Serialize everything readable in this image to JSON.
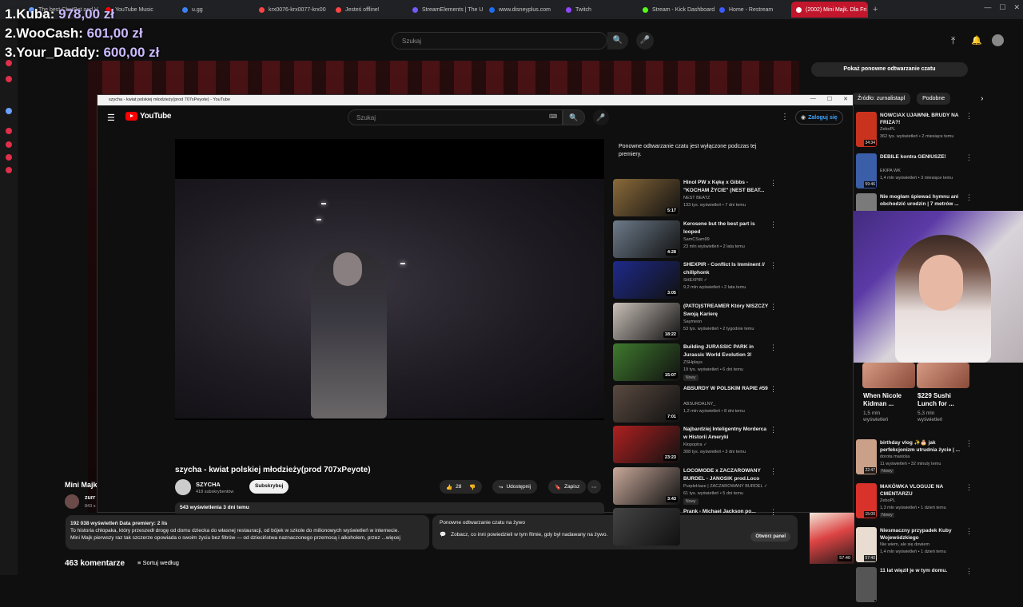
{
  "browser": {
    "tabs": [
      {
        "label": "The best ChatBot and V",
        "color": "#6aa0ff"
      },
      {
        "label": "YouTube Music",
        "color": "#ff0000"
      },
      {
        "label": "u.gg",
        "color": "#3b82f6"
      },
      {
        "label": "krx0076-krx0077-krx00",
        "color": "#ff4444"
      },
      {
        "label": "Jesteś offline!",
        "color": "#ff4444"
      },
      {
        "label": "StreamElements | The U",
        "color": "#6f5bff"
      },
      {
        "label": "www.disneyplus.com",
        "color": "#1b6ef3"
      },
      {
        "label": "Twitch",
        "color": "#9146ff"
      },
      {
        "label": "Stream - Kick Dashboard",
        "color": "#53fc18"
      },
      {
        "label": "Home - Restream",
        "color": "#3b5bfd"
      },
      {
        "label": "(2002) Mini Majk. Dla Fri",
        "color": "#ffffff",
        "active": true
      }
    ],
    "new_tab": "+"
  },
  "leaderboard": [
    {
      "rank": "1.",
      "name": "Kuba",
      "amount": "978,00 zł"
    },
    {
      "rank": "2.",
      "name": "WooCash",
      "amount": "601,00 zł"
    },
    {
      "rank": "3.",
      "name": "Your_Daddy",
      "amount": "600,00 zł"
    }
  ],
  "background_page": {
    "search_placeholder": "Szukaj",
    "replay_button": "Pokaż ponowne odtwarzanie czatu",
    "chips": [
      "Źródło: zurnalistapl",
      "Podobne"
    ],
    "related": [
      {
        "title": "NOWCIAX UJAWNIŁ BRUDY NA FRIZA?!",
        "channel": "ZeboPL",
        "meta": "362 tys. wyświetleń • 2 miesiące temu",
        "duration": "34:34"
      },
      {
        "title": "DEBILE kontra GENIUSZE!",
        "channel": "EKIPA WK",
        "meta": "1,4 mln wyświetleń • 3 miesiące temu",
        "duration": "59:46"
      },
      {
        "title": "Nie mogłam śpiewać hymnu ani obchodzić urodzin | 7 metrów ...",
        "channel": "",
        "meta": "",
        "duration": ""
      },
      {
        "title": "birthday vlog ✨🎂 jak perfekcjonizm utrudnia życie | ...",
        "channel": "dorota masicka",
        "meta": "11 wyświetleń • 32 minuty temu",
        "duration": "22:47",
        "badge": "Nowy"
      },
      {
        "title": "MAKÓWKA VLOGUJE NA CMENTARZU",
        "channel": "ZeboPL",
        "meta": "1,3 mln wyświetleń • 1 dzień temu",
        "duration": "15:00",
        "badge": "Nowy"
      },
      {
        "title": "Niesmaczny przypadek Kuby Wojewódzkiego",
        "channel": "Nie wiem, ale się dowiem",
        "meta": "1,4 mln wyświetleń • 1 dzień temu",
        "duration": "57:40"
      },
      {
        "title": "11 lat więził je w tym domu.",
        "channel": "",
        "meta": "",
        "duration": ""
      }
    ],
    "shorts": [
      {
        "title": "When Nicole Kidman ...",
        "meta": "1,5 mln wyświetleń"
      },
      {
        "title": "$229 Sushi Lunch for ...",
        "meta": "5,3 mln wyświetleń"
      }
    ],
    "mini_channel": "Mini Majk",
    "mini_sub": "zurr",
    "mini_count": "843 s",
    "description": {
      "stats": "192 038 wyświetleń  Data premiery: 2 lis",
      "line1": "To historia chłopaka, który przeszedł drogę od domu dziecka do własnej restauracji, od bójek w szkole do milionowych wyświetleń w internecie.",
      "line2": "Mini Majk pierwszy raz tak szczerze opowiada o swoim życiu bez filtrów — od dzieciństwa naznaczonego przemocą i alkoholem, przez ...więcej"
    },
    "replay_box": {
      "title": "Ponowne odtwarzanie czatu na żywo",
      "text": "Zobacz, co inni powiedzieli w tym filmie, gdy był nadawany na żywo.",
      "button": "Otwórz panel"
    },
    "comments_count": "463 komentarze",
    "sort_label": "Sortuj według",
    "corner_duration": "57:40"
  },
  "popup": {
    "window_title": "szycha - kwiat polskiej młodzieży(prod 707xPeyote) - YouTube",
    "logo": "YouTube",
    "search_placeholder": "Szukaj",
    "sign_in": "Zaloguj się",
    "video": {
      "title": "szycha - kwiat polskiej młodzieży(prod 707xPeyote)",
      "channel": "SZYCHA",
      "subscribers": "418 subskrybentów",
      "subscribe": "Subskrybuj",
      "likes": "28",
      "share": "Udostępnij",
      "save": "Zapisz",
      "views": "543 wyświetlenia  3 dni temu"
    },
    "chat_note": "Ponowne odtwarzanie czatu jest wyłączone podczas tej premiery.",
    "recommendations": [
      {
        "title": "Hinol PW x Kękę x Gibbs - \"KOCHAM ŻYCIE\" (NEST BEAT...",
        "channel": "NEST BEATZ",
        "meta": "133 tys. wyświetleń • 7 dni temu",
        "duration": "5:17",
        "color": "#8a6a3a"
      },
      {
        "title": "Kerosene but the best part is looped",
        "channel": "SamCSam99",
        "meta": "23 mln wyświetleń • 2 lata temu",
        "duration": "4:28",
        "color": "#6d7b8a"
      },
      {
        "title": "SHEXPIR - Conflict Is Imminent // chillphonk",
        "channel": "SHEXPIR ✓",
        "meta": "9,2 mln wyświetleń • 2 lata temu",
        "duration": "3:05",
        "color": "#1e2a8a"
      },
      {
        "title": "(PATO)STREAMER Który NISZCZY Swoją Karierę",
        "channel": "Saymeon",
        "meta": "53 tys. wyświetleń • 2 tygodnie temu",
        "duration": "18:22",
        "color": "#c9c0b8"
      },
      {
        "title": "Building JURASSIC PARK in Jurassic World Evolution 3!",
        "channel": "ZSHplays",
        "meta": "19 tys. wyświetleń • 6 dni temu",
        "duration": "15:07",
        "badge": "Nowy",
        "color": "#3f7a2e"
      },
      {
        "title": "ABSURDY W POLSKIM RAPIE #59",
        "channel": "ABSURDALNY_",
        "meta": "1,2 mln wyświetleń • 8 dni temu",
        "duration": "7:01",
        "color": "#5a4a40"
      },
      {
        "title": "Najbardziej Inteligentny Morderca w Historii Ameryki",
        "channel": "Kłopoptra ✓",
        "meta": "308 tys. wyświetleń • 3 dni temu",
        "duration": "23:23",
        "color": "#b02020"
      },
      {
        "title": "LOCOMODE x ZACZAROWANY BURDEL - JANOSIK prod.Loco",
        "channel": "PurpleHaze | ZACZAROWANY BURDEL ✓",
        "meta": "61 tys. wyświetleń • 5 dni temu",
        "duration": "3:43",
        "badge": "Nowy",
        "color": "#c8a89a"
      },
      {
        "title": "Prank - Michael Jackson po...",
        "channel": "",
        "meta": "",
        "duration": "",
        "color": "#444"
      }
    ]
  },
  "icons": {
    "search": "🔍",
    "mic": "🎤",
    "menu": "☰",
    "kebab": "⋮",
    "like": "👍",
    "share": "↪",
    "save": "🔖",
    "chat": "💬"
  }
}
